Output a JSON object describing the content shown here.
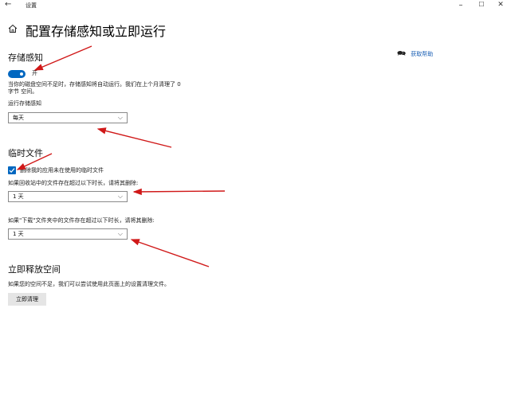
{
  "window": {
    "back_glyph": "←",
    "title": "设置",
    "minimize_glyph": "–",
    "maximize_glyph": "☐",
    "close_glyph": "✕"
  },
  "page": {
    "title": "配置存储感知或立即运行"
  },
  "help": {
    "icon": "chat-help-icon",
    "label": "获取帮助"
  },
  "storage_sense": {
    "heading": "存储感知",
    "toggle_state": true,
    "toggle_label": "开",
    "description_line1": "当你的磁盘空间不足时，存储感知将自动运行。我们在上个月清理了 0",
    "description_line2": "字节 空间。",
    "run_label": "运行存储感知",
    "run_value": "每天"
  },
  "temp_files": {
    "heading": "临时文件",
    "checkbox_checked": true,
    "checkbox_label": "删除我的应用未在使用的临时文件",
    "recycle_label": "如果回收站中的文件存在超过以下时长，请将其删除:",
    "recycle_value": "1 天",
    "downloads_label": "如果\"下载\"文件夹中的文件存在超过以下时长，请将其删除:",
    "downloads_value": "1 天"
  },
  "free_space": {
    "heading": "立即释放空间",
    "description": "如果您的空间不足，我们可以尝试使用此页面上的设置清理文件。",
    "button_label": "立即清理"
  },
  "colors": {
    "accent": "#0067c0",
    "annotation": "#d01818",
    "link": "#1a5fb4"
  }
}
